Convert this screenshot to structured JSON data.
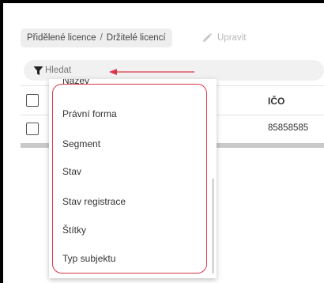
{
  "breadcrumb": {
    "item1": "Přidělené licence",
    "separator": "/",
    "item2": "Držitelé licencí"
  },
  "toolbar": {
    "edit_label": "Upravit",
    "edit_icon": "pencil-icon"
  },
  "search": {
    "filter_icon": "filter-funnel-icon",
    "placeholder": "Hledat"
  },
  "annotation": {
    "arrow_color": "#d9364a"
  },
  "table": {
    "headers": {
      "ico": "IČO"
    },
    "rows": [
      {
        "ico": "85858585"
      }
    ]
  },
  "dropdown": {
    "items": [
      {
        "label": "Název"
      },
      {
        "label": "Právní forma"
      },
      {
        "label": "Segment"
      },
      {
        "label": "Stav"
      },
      {
        "label": "Stav registrace"
      },
      {
        "label": "Štítky"
      },
      {
        "label": "Typ subjektu"
      }
    ],
    "highlight_color": "#d9364a"
  }
}
